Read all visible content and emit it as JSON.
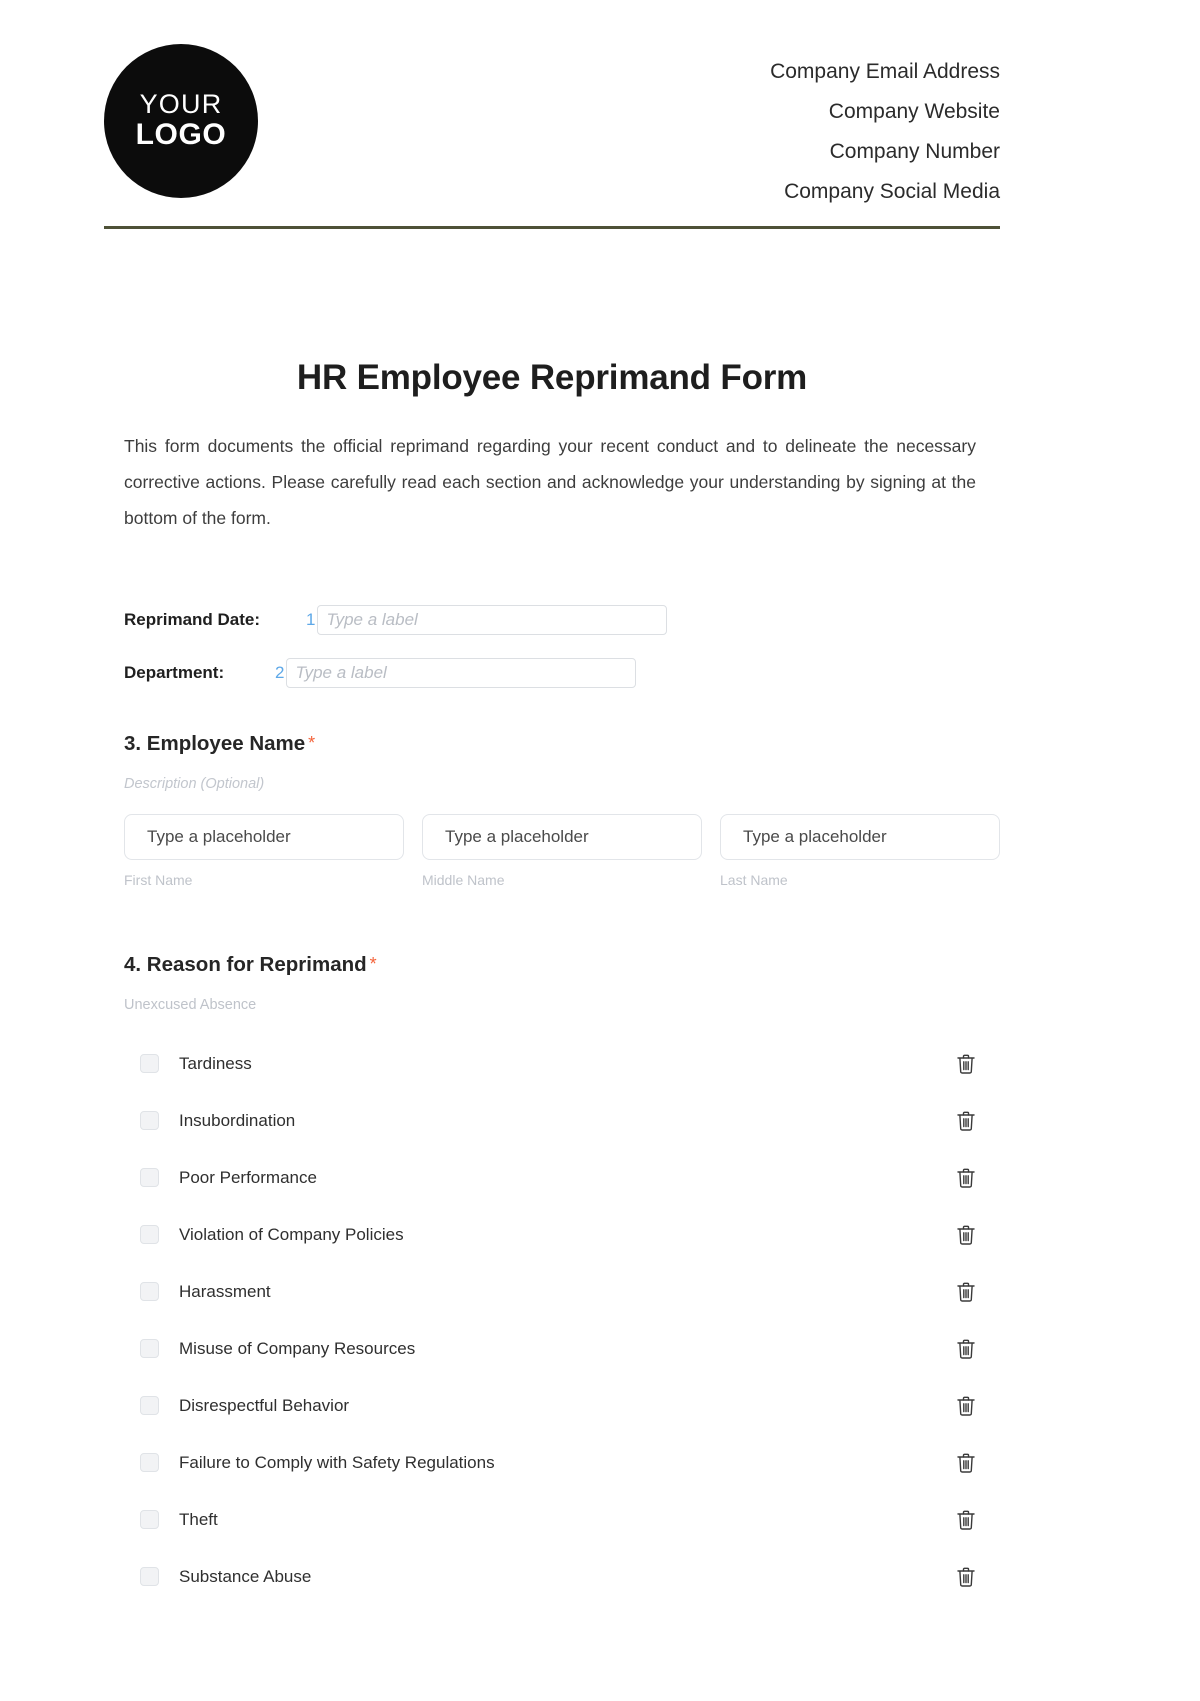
{
  "header": {
    "logo": {
      "line1": "YOUR",
      "line2": "LOGO"
    },
    "contact_lines": [
      "Company Email Address",
      "Company Website",
      "Company Number",
      "Company Social Media"
    ],
    "rule_color": "#4e5137"
  },
  "document": {
    "title": "HR Employee Reprimand Form",
    "intro": "This form documents the official reprimand regarding your recent conduct and to delineate the necessary corrective actions. Please carefully read each section and acknowledge your understanding by signing at the bottom of the form."
  },
  "inline_fields": [
    {
      "label": "Reprimand Date:",
      "index": "1",
      "placeholder": "Type a label",
      "value": ""
    },
    {
      "label": "Department:",
      "index": "2",
      "placeholder": "Type a label",
      "value": ""
    }
  ],
  "sections": [
    {
      "number": "3.",
      "title": "3. Employee Name",
      "required_marker": "*",
      "description": "Description (Optional)",
      "name_fields": [
        {
          "placeholder": "Type a placeholder",
          "sub_label": "First Name"
        },
        {
          "placeholder": "Type a placeholder",
          "sub_label": "Middle Name"
        },
        {
          "placeholder": "Type a placeholder",
          "sub_label": "Last Name"
        }
      ]
    },
    {
      "number": "4.",
      "title": "4. Reason for Reprimand",
      "required_marker": "*",
      "sub_text": "Unexcused Absence",
      "options": [
        {
          "label": "Tardiness",
          "checked": false,
          "delete_icon": "trash-icon"
        },
        {
          "label": "Insubordination",
          "checked": false,
          "delete_icon": "trash-icon"
        },
        {
          "label": "Poor Performance",
          "checked": false,
          "delete_icon": "trash-icon"
        },
        {
          "label": "Violation of Company Policies",
          "checked": false,
          "delete_icon": "trash-icon"
        },
        {
          "label": "Harassment",
          "checked": false,
          "delete_icon": "trash-icon"
        },
        {
          "label": "Misuse of Company Resources",
          "checked": false,
          "delete_icon": "trash-icon"
        },
        {
          "label": "Disrespectful Behavior",
          "checked": false,
          "delete_icon": "trash-icon"
        },
        {
          "label": "Failure to Comply with Safety Regulations",
          "checked": false,
          "delete_icon": "trash-icon"
        },
        {
          "label": "Theft",
          "checked": false,
          "delete_icon": "trash-icon"
        },
        {
          "label": "Substance Abuse",
          "checked": false,
          "delete_icon": "trash-icon"
        }
      ]
    }
  ],
  "colors": {
    "accent_index": "#5ea8e8",
    "required": "#f4633a",
    "rule": "#4e5137",
    "logo_bg": "#0c0c0c"
  }
}
